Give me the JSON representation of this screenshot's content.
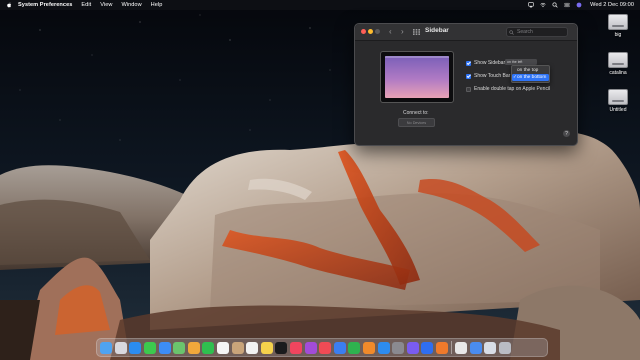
{
  "menubar": {
    "app_name": "System Preferences",
    "items": [
      "Edit",
      "View",
      "Window",
      "Help"
    ],
    "clock": "Wed 2 Dec  09:00"
  },
  "desktop_icons": [
    {
      "label": "big"
    },
    {
      "label": "catalina"
    },
    {
      "label": "Untitled"
    }
  ],
  "window": {
    "title": "Sidebar",
    "search_placeholder": "Search",
    "show_sidebar_label": "Show Sidebar",
    "show_sidebar_checked": true,
    "sidebar_position_value": "on the left",
    "show_touch_bar_label": "Show Touch Bar",
    "show_touch_bar_checked": true,
    "touch_bar_menu": {
      "options": [
        "on the top",
        "on the bottom"
      ],
      "selected": "on the bottom"
    },
    "double_tap_label": "Enable double tap on Apple Pencil",
    "double_tap_checked": false,
    "connect_label": "Connect to:",
    "device_button": "No Devices",
    "help_label": "?"
  },
  "dock": {
    "apps": [
      {
        "name": "finder-icon",
        "color": "#4fa3f0"
      },
      {
        "name": "launchpad-icon",
        "color": "#d8d8de"
      },
      {
        "name": "safari-icon",
        "color": "#2b8cf0"
      },
      {
        "name": "messages-icon",
        "color": "#3cc94e"
      },
      {
        "name": "mail-icon",
        "color": "#3d8df5"
      },
      {
        "name": "maps-icon",
        "color": "#6bc46d"
      },
      {
        "name": "photos-icon",
        "color": "#f2a83b"
      },
      {
        "name": "facetime-icon",
        "color": "#2fbf4f"
      },
      {
        "name": "calendar-icon",
        "color": "#f5f5f5"
      },
      {
        "name": "contacts-icon",
        "color": "#c9a47a"
      },
      {
        "name": "reminders-icon",
        "color": "#f2f2f2"
      },
      {
        "name": "notes-icon",
        "color": "#f6d24c"
      },
      {
        "name": "tv-icon",
        "color": "#1b1b1d"
      },
      {
        "name": "music-icon",
        "color": "#f0455e"
      },
      {
        "name": "podcasts-icon",
        "color": "#a24cd8"
      },
      {
        "name": "news-icon",
        "color": "#f04b55"
      },
      {
        "name": "keynote-icon",
        "color": "#3b7ef0"
      },
      {
        "name": "numbers-icon",
        "color": "#2fb34f"
      },
      {
        "name": "pages-icon",
        "color": "#f08a2b"
      },
      {
        "name": "app-store-icon",
        "color": "#2d8cf0"
      },
      {
        "name": "system-preferences-icon",
        "color": "#8a8a90"
      },
      {
        "name": "feedback-icon",
        "color": "#7a5cf0"
      },
      {
        "name": "sidecar-icon",
        "color": "#2f6ef0"
      },
      {
        "name": "firefox-icon",
        "color": "#f07a2b"
      },
      {
        "name": "chrome-icon",
        "color": "#e8e8e8"
      },
      {
        "name": "downloads-icon",
        "color": "#4a8cf0"
      },
      {
        "name": "preview-icon",
        "color": "#d8dde6"
      },
      {
        "name": "trash-icon",
        "color": "#b9bcc4"
      }
    ]
  }
}
